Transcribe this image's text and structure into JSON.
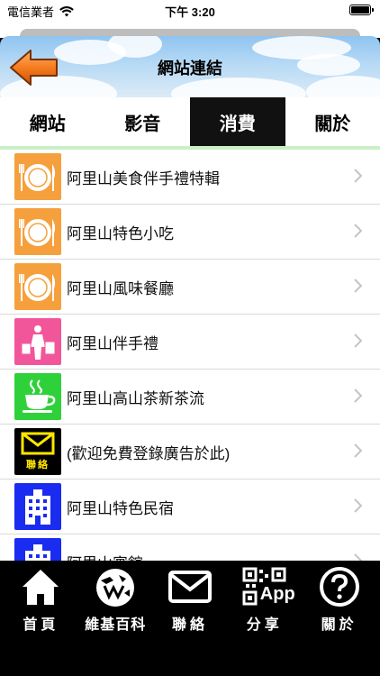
{
  "status": {
    "carrier": "電信業者",
    "time": "下午 3:20",
    "wifi_icon": "wifi-icon",
    "battery_icon": "battery-icon"
  },
  "header": {
    "title": "網站連結",
    "back_icon": "back-arrow-icon"
  },
  "tabs": [
    {
      "label": "網站",
      "active": false
    },
    {
      "label": "影音",
      "active": false
    },
    {
      "label": "消費",
      "active": true
    },
    {
      "label": "關於",
      "active": false
    }
  ],
  "list": {
    "items": [
      {
        "label": "阿里山美食伴手禮特輯",
        "icon": "dining-icon",
        "color": "#f5a03c"
      },
      {
        "label": "阿里山特色小吃",
        "icon": "dining-icon",
        "color": "#f5a03c"
      },
      {
        "label": "阿里山風味餐廳",
        "icon": "dining-icon",
        "color": "#f5a03c"
      },
      {
        "label": "阿里山伴手禮",
        "icon": "shopping-icon",
        "color": "#f2569a"
      },
      {
        "label": "阿里山高山茶新茶流",
        "icon": "tea-cup-icon",
        "color": "#2fd13a"
      },
      {
        "label": "(歡迎免費登錄廣告於此)",
        "icon": "mail-icon",
        "color": "#000000",
        "icon_text": "聯絡"
      },
      {
        "label": "阿里山特色民宿",
        "icon": "building-icon",
        "color": "#1a2cf0"
      },
      {
        "label": "阿里山賓館",
        "icon": "building-icon",
        "color": "#1a2cf0"
      }
    ]
  },
  "tabbar": [
    {
      "label": "首頁",
      "icon": "home-icon"
    },
    {
      "label": "維基百科",
      "icon": "wikipedia-icon"
    },
    {
      "label": "聯絡",
      "icon": "mail-icon"
    },
    {
      "label": "分享",
      "icon": "qr-app-icon",
      "icon_text": "App"
    },
    {
      "label": "關於",
      "icon": "question-icon"
    }
  ],
  "colors": {
    "tab_underline": "#c8f0c8",
    "active_tab": "#111111",
    "back_arrow": "#f57c1f"
  }
}
